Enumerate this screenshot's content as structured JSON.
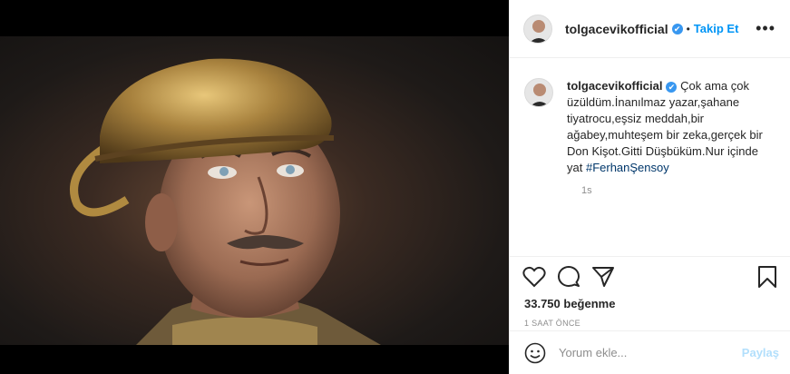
{
  "post": {
    "username": "tolgacevikofficial",
    "verified_mark": "✔",
    "separator": "•",
    "follow_label": "Takip Et",
    "more_label": "•••",
    "caption_text": "Çok ama çok üzüldüm.İnanılmaz yazar,şahane tiyatrocu,eşsiz meddah,bir ağabey,muhteşem bir zeka,gerçek bir Don Kişot.Gitti Düşbüküm.Nur içinde yat",
    "hashtag": "#FerhanŞensoy",
    "caption_time": "1s",
    "likes": "33.750 beğenme",
    "time_ago": "1 SAAT ÖNCE",
    "comment_placeholder": "Yorum ekle...",
    "post_button": "Paylaş"
  },
  "icons": [
    "heart-icon",
    "comment-icon",
    "share-icon",
    "bookmark-icon",
    "emoji-icon",
    "more-icon",
    "verified-icon"
  ],
  "colors": {
    "accent": "#0095f6",
    "verified": "#3897f0",
    "muted": "#8e8e8e",
    "hashtag": "#00376b",
    "post_disabled": "#b2dffc"
  }
}
